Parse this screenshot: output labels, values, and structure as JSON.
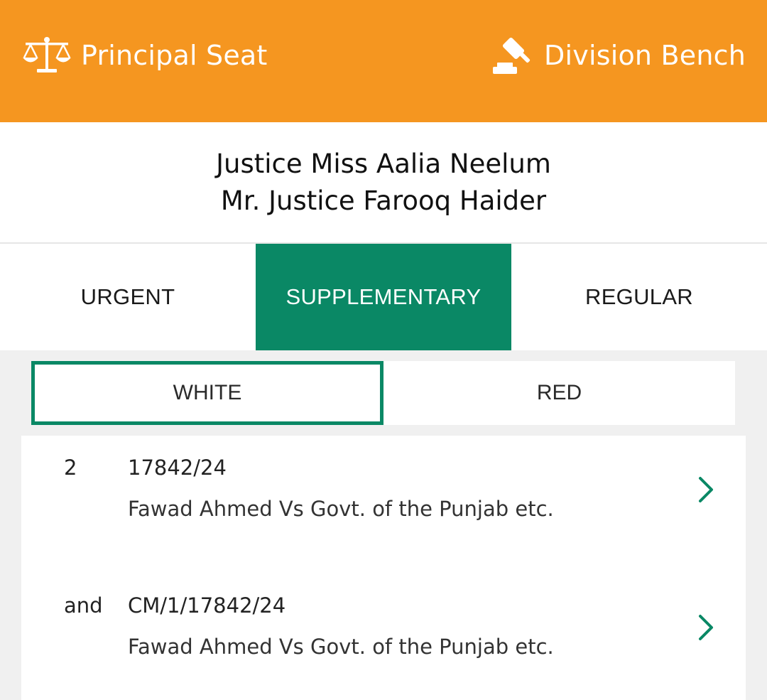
{
  "header": {
    "seat_label": "Principal Seat",
    "bench_label": "Division Bench",
    "icons": {
      "seat": "scales-icon",
      "bench": "gavel-icon"
    },
    "colors": {
      "background": "#f59620",
      "text": "#ffffff"
    }
  },
  "judges": {
    "line1": "Justice Miss Aalia Neelum",
    "line2": "Mr. Justice Farooq Haider"
  },
  "tabs": [
    {
      "label": "URGENT",
      "active": false
    },
    {
      "label": "SUPPLEMENTARY",
      "active": true
    },
    {
      "label": "REGULAR",
      "active": false
    }
  ],
  "subtabs": [
    {
      "label": "WHITE",
      "selected": true
    },
    {
      "label": "RED",
      "selected": false
    }
  ],
  "cases": [
    {
      "serial": "2",
      "case_no": "17842/24",
      "title": "Fawad Ahmed Vs Govt. of the Punjab etc."
    },
    {
      "serial": "and",
      "case_no": "CM/1/17842/24",
      "title": "Fawad Ahmed Vs Govt. of the Punjab etc."
    }
  ],
  "colors": {
    "accent": "#0a8865",
    "page_background": "#f0f0f0"
  }
}
